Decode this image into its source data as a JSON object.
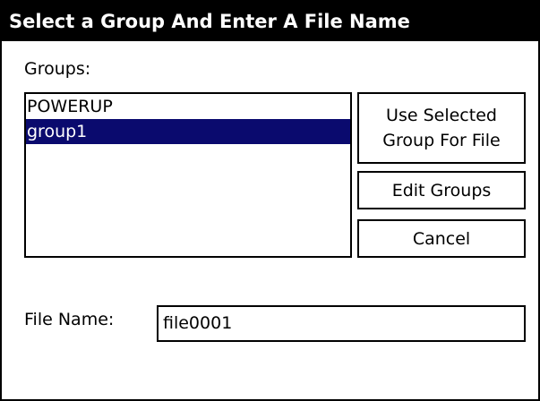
{
  "dialog": {
    "title": "Select a Group And Enter A File Name"
  },
  "groups": {
    "label": "Groups:",
    "items": [
      {
        "label": "POWERUP",
        "selected": false
      },
      {
        "label": "group1",
        "selected": true
      }
    ]
  },
  "buttons": {
    "use_selected_line1": "Use Selected",
    "use_selected_line2": "Group For File",
    "edit_groups": "Edit Groups",
    "cancel": "Cancel"
  },
  "file_name": {
    "label": "File Name:",
    "value": "file0001"
  },
  "colors": {
    "title_bar": "#000000",
    "selection": "#0a0a6e"
  }
}
